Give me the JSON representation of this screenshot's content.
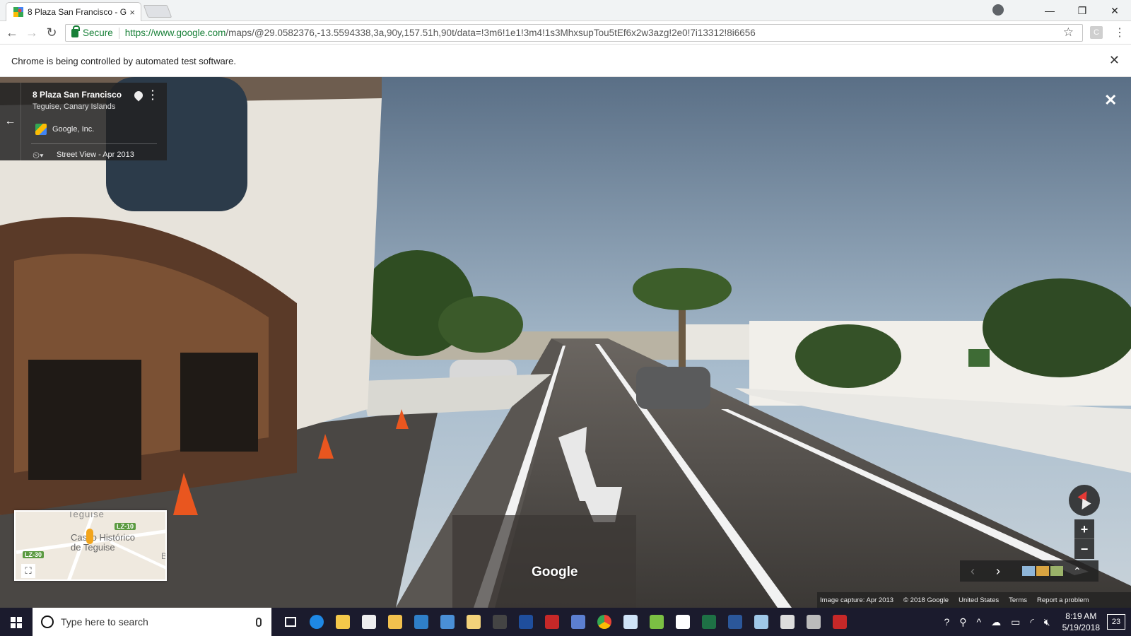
{
  "browser": {
    "tab_title": "8 Plaza San Francisco - G",
    "tab_close": "×",
    "secure_label": "Secure",
    "url_host": "https://www.google.com",
    "url_path": "/maps/@29.0582376,-13.5594338,3a,90y,157.51h,90t/data=!3m6!1e1!3m4!1s3MhxsupTou5tEf6x2w3azg!2e0!7i13312!8i6656",
    "ext_label": "C",
    "window_buttons": {
      "minimize": "—",
      "restore": "❐",
      "close": "✕"
    }
  },
  "infobar": {
    "message": "Chrome is being controlled by automated test software.",
    "close": "✕"
  },
  "streetview": {
    "place_title": "8 Plaza San Francisco",
    "place_subtitle": "Teguise, Canary Islands",
    "provider": "Google, Inc.",
    "date_label": "Street View - Apr 2013",
    "back_arrow": "←",
    "close": "✕",
    "watermark": "Google",
    "minimap": {
      "town": "Teguise",
      "label_line1": "Casco Histórico",
      "label_line2": "de Teguise",
      "badge_lz10": "LZ-10",
      "badge_lz30": "LZ-30",
      "edge_letter": "B",
      "expand_icon": "⛶"
    },
    "zoom_in": "+",
    "zoom_out": "−",
    "film_prev": "‹",
    "film_next": "›",
    "film_up": "⌃",
    "footer": {
      "capture": "Image capture: Apr 2013",
      "copyright": "© 2018 Google",
      "region": "United States",
      "terms": "Terms",
      "report": "Report a problem"
    }
  },
  "taskbar": {
    "search_placeholder": "Type here to search",
    "time": "8:19 AM",
    "date": "5/19/2018",
    "notifications": "23"
  }
}
